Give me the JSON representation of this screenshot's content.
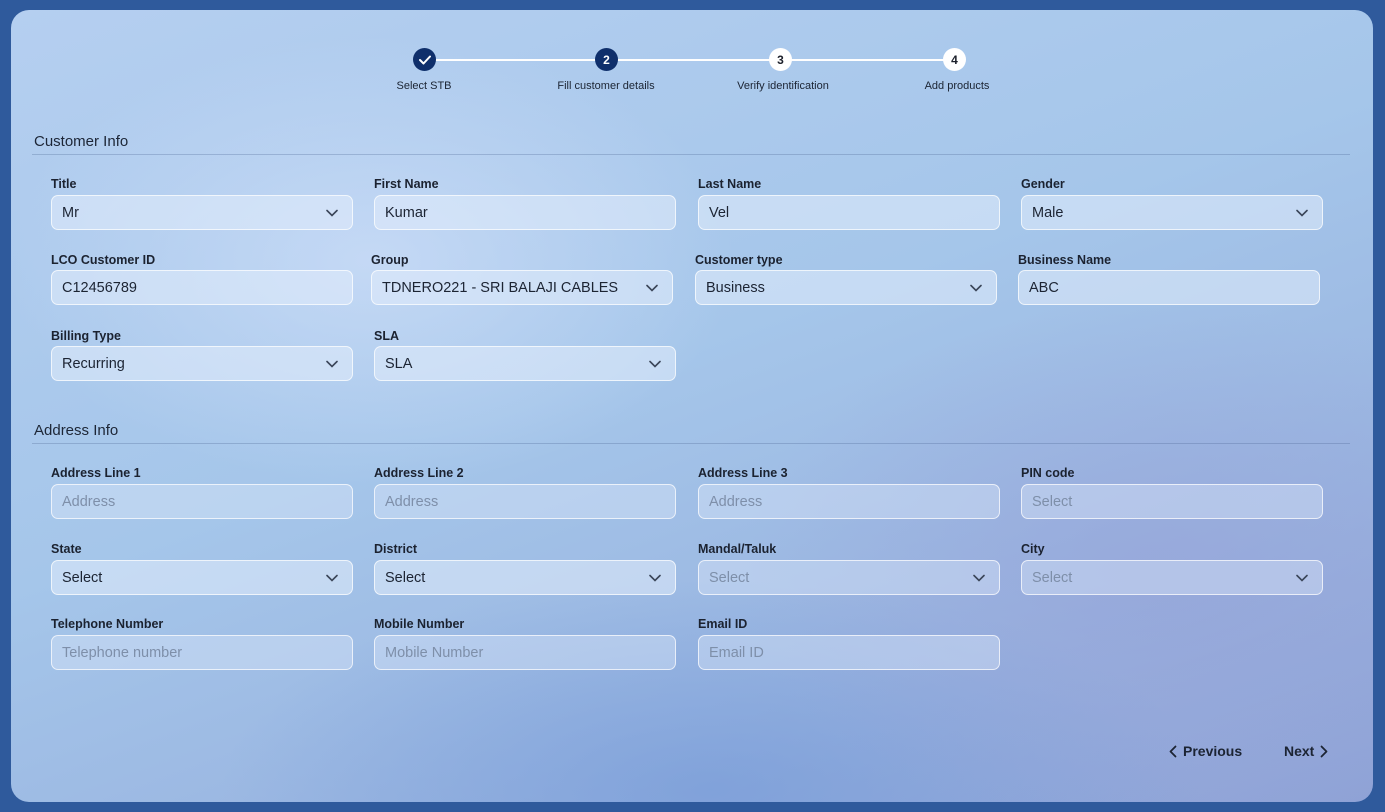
{
  "stepper": {
    "steps": [
      {
        "number": "1",
        "label": "Select STB",
        "state": "done"
      },
      {
        "number": "2",
        "label": "Fill customer details",
        "state": "active"
      },
      {
        "number": "3",
        "label": "Verify identification",
        "state": "todo"
      },
      {
        "number": "4",
        "label": "Add products",
        "state": "todo"
      }
    ]
  },
  "customer_info": {
    "title": "Customer Info",
    "fields": {
      "title": {
        "label": "Title",
        "value": "Mr",
        "type": "select"
      },
      "first_name": {
        "label": "First Name",
        "value": "Kumar",
        "type": "text"
      },
      "last_name": {
        "label": "Last Name",
        "value": "Vel",
        "type": "text"
      },
      "gender": {
        "label": "Gender",
        "value": "Male",
        "type": "select"
      },
      "lco_customer_id": {
        "label": "LCO Customer ID",
        "value": "C12456789",
        "type": "text"
      },
      "group": {
        "label": "Group",
        "value": "TDNERO221 - SRI BALAJI CABLES",
        "type": "select"
      },
      "customer_type": {
        "label": "Customer type",
        "value": "Business",
        "type": "select"
      },
      "business_name": {
        "label": "Business Name",
        "value": "ABC",
        "type": "text"
      },
      "billing_type": {
        "label": "Billing Type",
        "value": "Recurring",
        "type": "select"
      },
      "sla": {
        "label": "SLA",
        "value": "SLA",
        "type": "select"
      }
    }
  },
  "address_info": {
    "title": "Address Info",
    "fields": {
      "address_line_1": {
        "label": "Address Line 1",
        "placeholder": "Address",
        "type": "text"
      },
      "address_line_2": {
        "label": "Address Line 2",
        "placeholder": "Address",
        "type": "text"
      },
      "address_line_3": {
        "label": "Address Line 3",
        "placeholder": "Address",
        "type": "text"
      },
      "pin_code": {
        "label": "PIN code",
        "placeholder": "Select",
        "type": "text"
      },
      "state": {
        "label": "State",
        "value": "Select",
        "type": "select"
      },
      "district": {
        "label": "District",
        "value": "Select",
        "type": "select"
      },
      "mandal_taluk": {
        "label": "Mandal/Taluk",
        "placeholder": "Select",
        "type": "select"
      },
      "city": {
        "label": "City",
        "placeholder": "Select",
        "type": "select"
      },
      "telephone_number": {
        "label": "Telephone Number",
        "placeholder": "Telephone number",
        "type": "text"
      },
      "mobile_number": {
        "label": "Mobile Number",
        "placeholder": "Mobile Number",
        "type": "text"
      },
      "email_id": {
        "label": "Email ID",
        "placeholder": "Email ID",
        "type": "text"
      }
    }
  },
  "navigation": {
    "previous_label": "Previous",
    "next_label": "Next"
  },
  "colors": {
    "step_active": "#0f2f6b",
    "text_primary": "#1c2433",
    "placeholder": "#7e8fa9"
  }
}
